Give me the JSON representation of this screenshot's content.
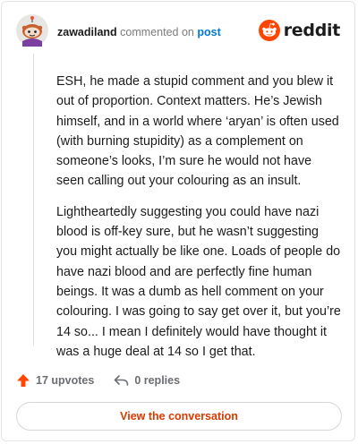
{
  "header": {
    "username": "zawadiland",
    "verb": "commented on",
    "post_link": "post",
    "brand": "reddit"
  },
  "comment": {
    "paragraphs": [
      "ESH, he made a stupid comment and you blew it out of proportion. Context matters. He’s Jewish himself, and in a world where ‘aryan’ is often used (with burning stupidity) as a complement on someone’s looks, I’m sure he would not have seen calling out your colouring as an insult.",
      "Lightheartedly suggesting you could have nazi blood is off-key sure, but he wasn’t suggesting you might actually be like one. Loads of people do have nazi blood and are perfectly fine human beings. It was a dumb as hell comment on your colouring. I was going to say get over it, but you’re 14 so... I mean I definitely would have thought it was a huge deal at 14 so I get that."
    ]
  },
  "actions": {
    "upvotes": "17 upvotes",
    "replies": "0 replies",
    "upvote_color": "#ff4500"
  },
  "cta": {
    "label": "View the conversation",
    "color": "#d93a00"
  },
  "colors": {
    "brand": "#ff4500",
    "link": "#0079d3"
  }
}
